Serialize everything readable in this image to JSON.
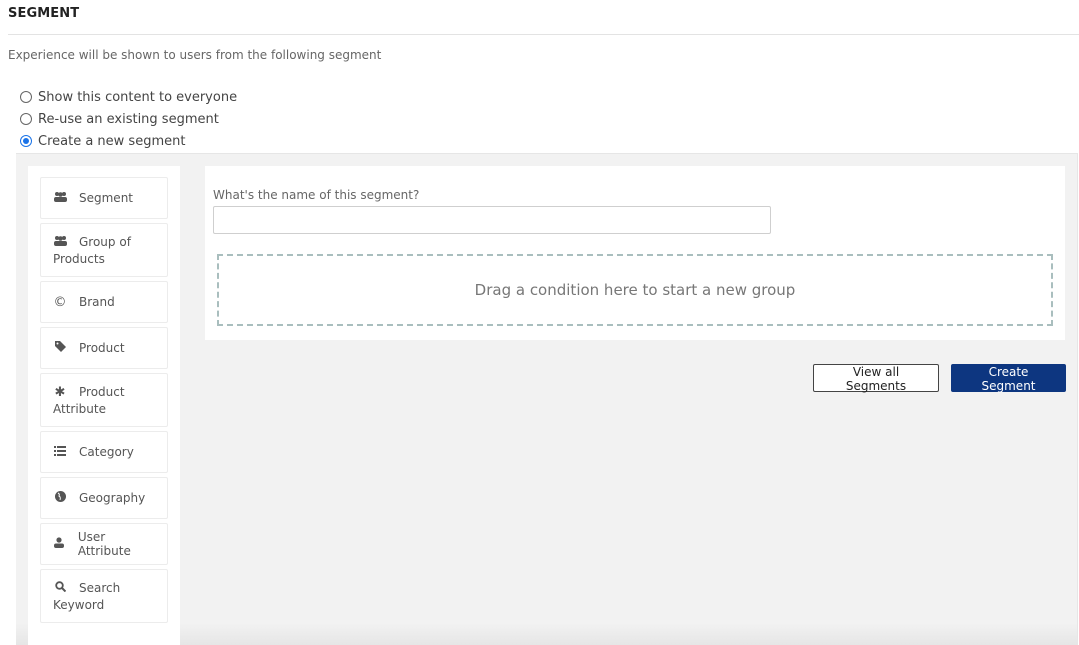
{
  "header": {
    "title": "SEGMENT",
    "description": "Experience will be shown to users from the following segment"
  },
  "audience_options": [
    {
      "label": "Show this content to everyone",
      "selected": false
    },
    {
      "label": "Re-use an existing segment",
      "selected": false
    },
    {
      "label": "Create a new segment",
      "selected": true
    }
  ],
  "conditions": [
    {
      "label": "Segment",
      "icon": "users-icon",
      "glyph": "👥"
    },
    {
      "label": "Group of Products",
      "icon": "users-icon",
      "glyph": "👥"
    },
    {
      "label": "Brand",
      "icon": "copyright-icon",
      "glyph": "©"
    },
    {
      "label": "Product",
      "icon": "tag-icon",
      "glyph": "🏷"
    },
    {
      "label": "Product Attribute",
      "icon": "asterisk-icon",
      "glyph": "✱"
    },
    {
      "label": "Category",
      "icon": "list-icon",
      "glyph": "☰"
    },
    {
      "label": "Geography",
      "icon": "globe-icon",
      "glyph": "🌐"
    },
    {
      "label": "User Attribute",
      "icon": "user-icon",
      "glyph": "👤"
    },
    {
      "label": "Search Keyword",
      "icon": "search-icon",
      "glyph": "🔍"
    }
  ],
  "form": {
    "name_label": "What's the name of this segment?",
    "name_value": "",
    "name_placeholder": "",
    "drop_zone_text": "Drag a condition here to start a new group"
  },
  "actions": {
    "view_all_label": "View all Segments",
    "create_label": "Create Segment"
  },
  "colors": {
    "primary": "#0d3680",
    "radio_selected": "#1a73e8",
    "drop_zone_border": "#a9bebe"
  }
}
